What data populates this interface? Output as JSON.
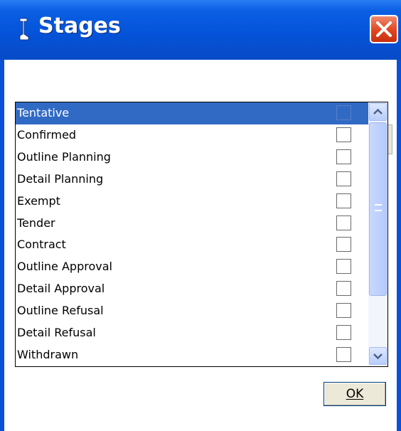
{
  "window": {
    "title": "Stages",
    "title_icon": "boot-icon",
    "close_icon": "close-icon"
  },
  "nav": {
    "prev_icon": "triangle-left-icon",
    "next_icon": "triangle-right-icon"
  },
  "list": {
    "selected_index": 0,
    "items": [
      {
        "label": "Tentative",
        "checked": false
      },
      {
        "label": "Confirmed",
        "checked": false
      },
      {
        "label": "Outline Planning",
        "checked": false
      },
      {
        "label": "Detail Planning",
        "checked": false
      },
      {
        "label": "Exempt",
        "checked": false
      },
      {
        "label": "Tender",
        "checked": false
      },
      {
        "label": "Contract",
        "checked": false
      },
      {
        "label": "Outline Approval",
        "checked": false
      },
      {
        "label": "Detail Approval",
        "checked": false
      },
      {
        "label": "Outline Refusal",
        "checked": false
      },
      {
        "label": "Detail Refusal",
        "checked": false
      },
      {
        "label": "Withdrawn",
        "checked": false
      }
    ]
  },
  "buttons": {
    "ok_label": "OK"
  },
  "colors": {
    "titlebar": "#0553d9",
    "selection": "#316ac5",
    "scrollbar": "#c3d3fd"
  }
}
